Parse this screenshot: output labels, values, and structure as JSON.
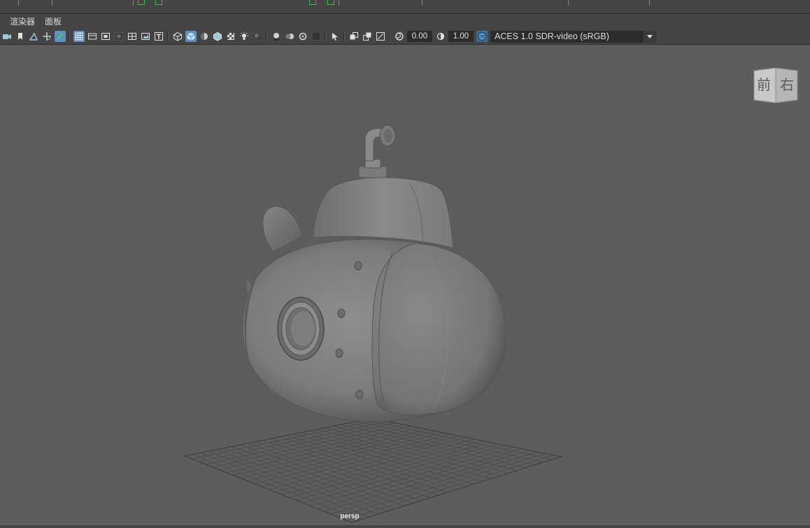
{
  "menu": {
    "items": [
      {
        "label": "渲染器"
      },
      {
        "label": "面板"
      }
    ]
  },
  "toolbar": {
    "exposure_value": "0.00",
    "gamma_value": "1.00",
    "color_space": "ACES 1.0 SDR-video (sRGB)"
  },
  "viewport": {
    "camera_label": "persp",
    "view_cube": {
      "front_label": "前",
      "right_label": "右"
    }
  },
  "colors": {
    "ui_panel": "#444444",
    "viewport_bg": "#5d5d5d",
    "active_button": "#5f8dbd",
    "timeline_key": "#36c24a"
  }
}
